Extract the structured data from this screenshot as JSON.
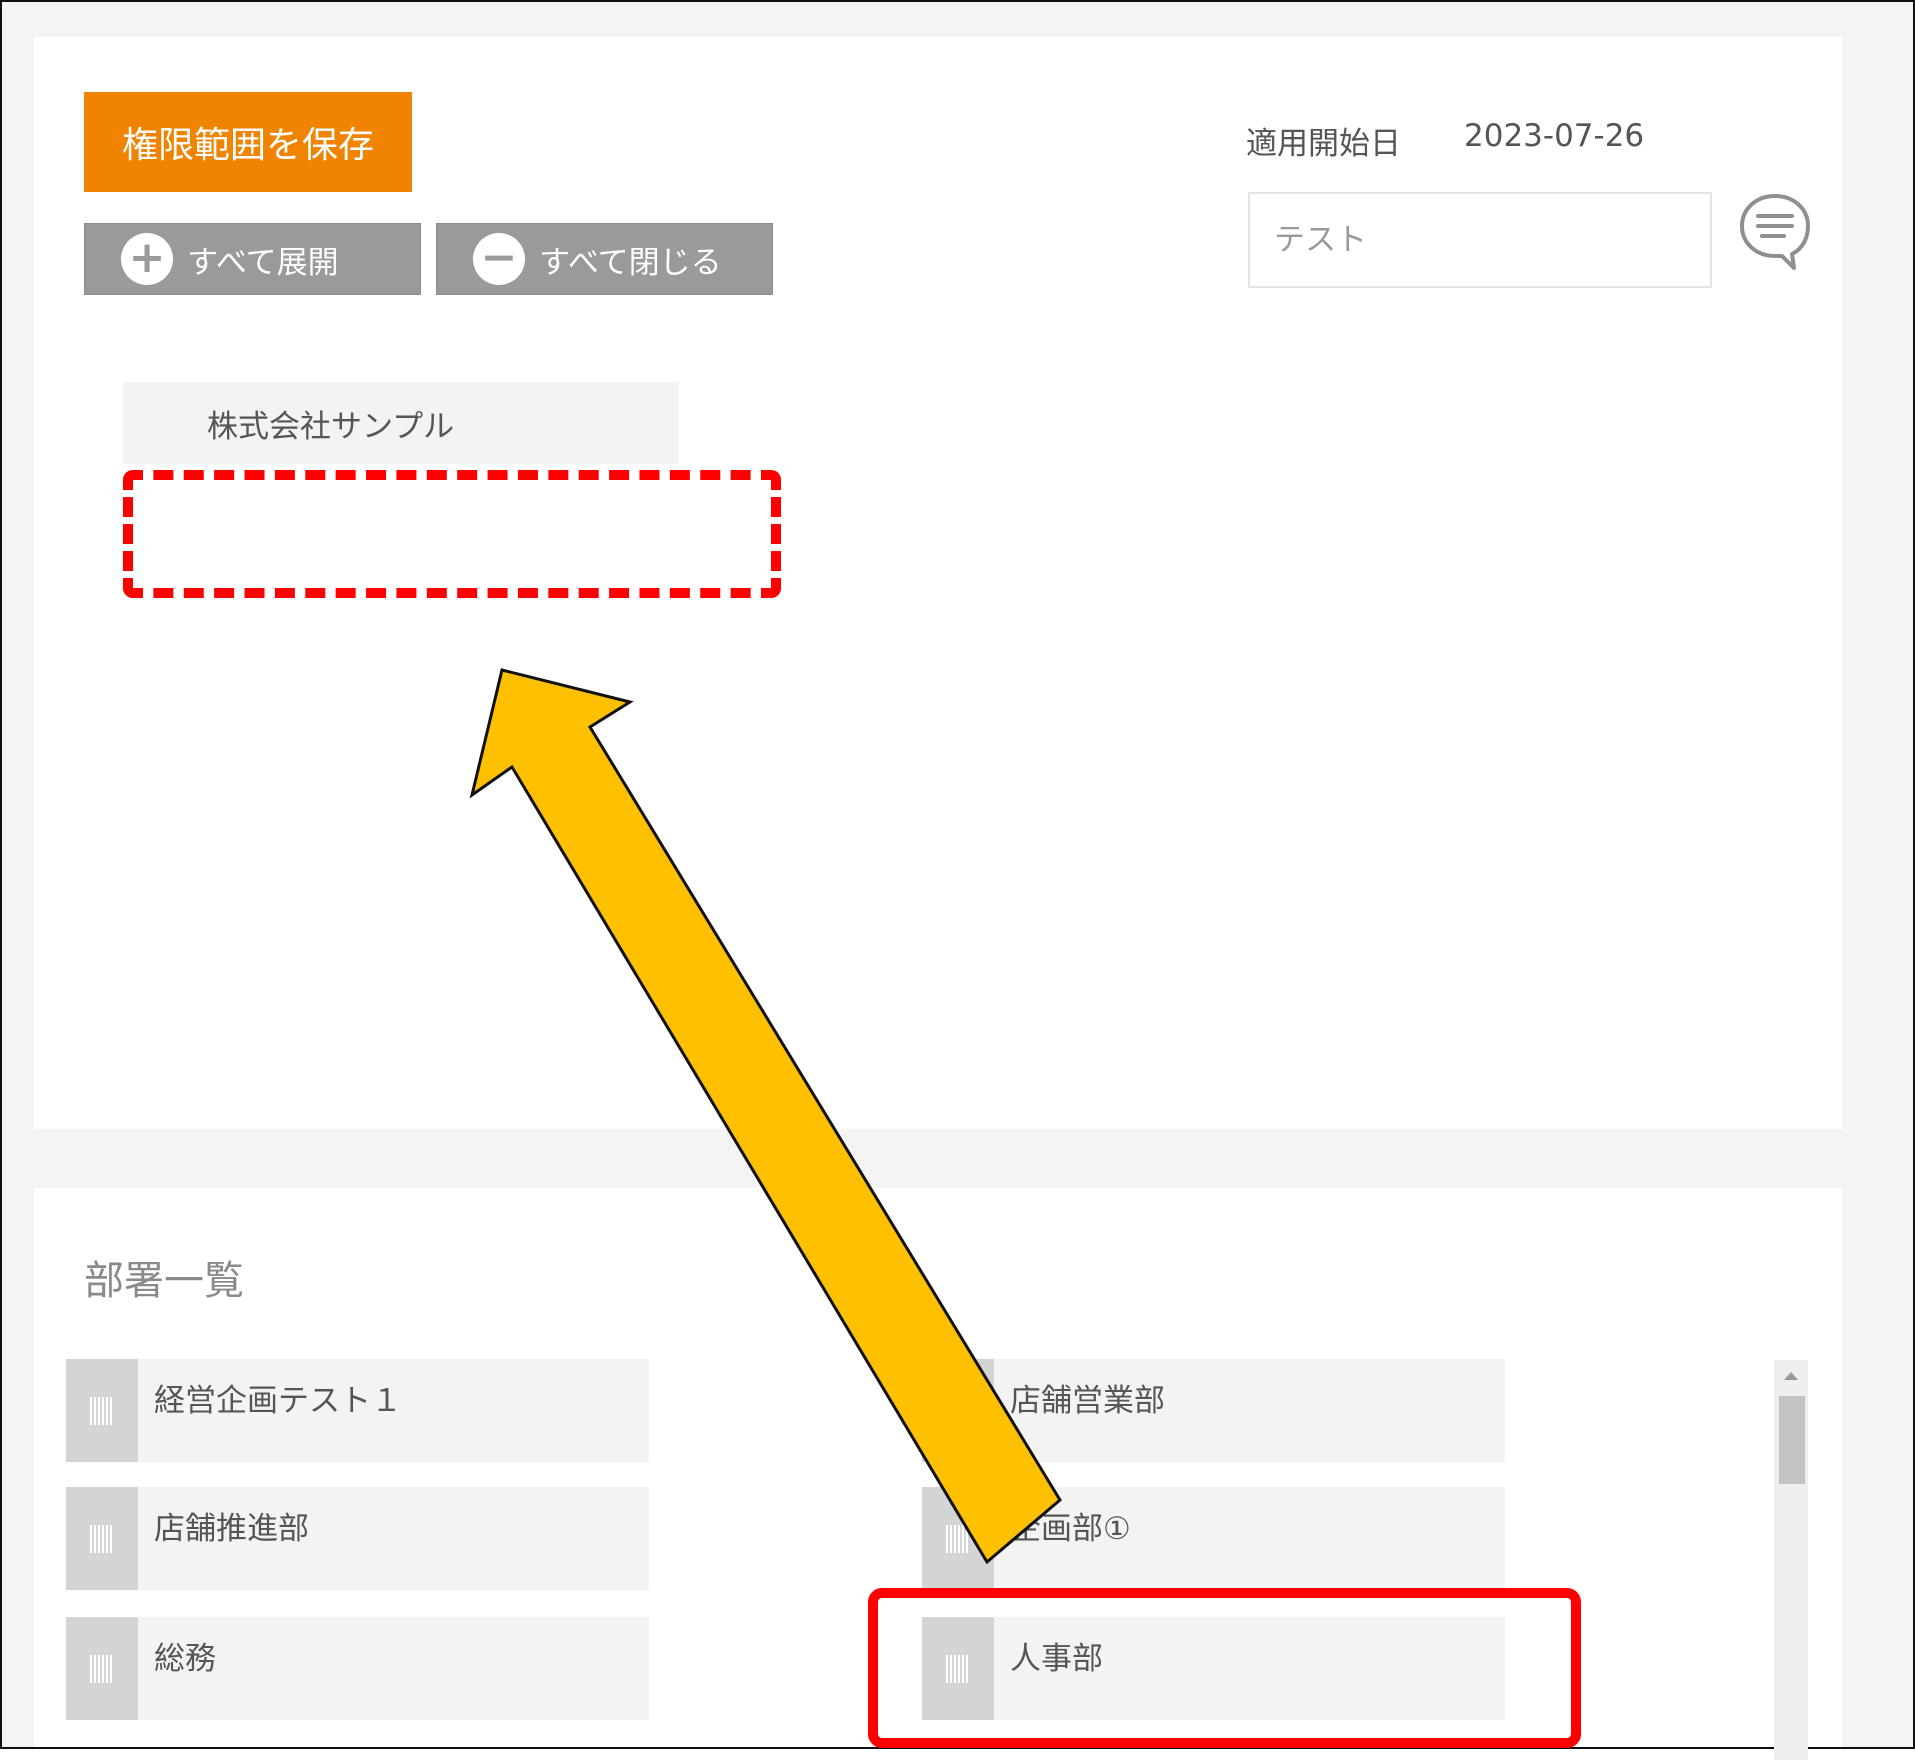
{
  "toolbar": {
    "save_label": "権限範囲を保存",
    "expand_all_label": "すべて展開",
    "collapse_all_label": "すべて閉じる"
  },
  "header": {
    "start_date_label": "適用開始日",
    "start_date_value": "2023-07-26",
    "name_input_placeholder": "テスト",
    "memo_icon": "speech-bubble-lines-icon"
  },
  "tree": {
    "root_label": "株式会社サンプル"
  },
  "department_list": {
    "title": "部署一覧",
    "items": [
      {
        "label": "経営企画テスト１"
      },
      {
        "label": "店舗営業部"
      },
      {
        "label": "店舗推進部"
      },
      {
        "label": "企画部①"
      },
      {
        "label": "総務"
      },
      {
        "label": "人事部"
      }
    ]
  },
  "annotations": {
    "colors": {
      "save_button": "#f08300",
      "drop_zone": "#ff0000",
      "highlight": "#ff0000",
      "arrow_fill": "#ffc000"
    }
  }
}
